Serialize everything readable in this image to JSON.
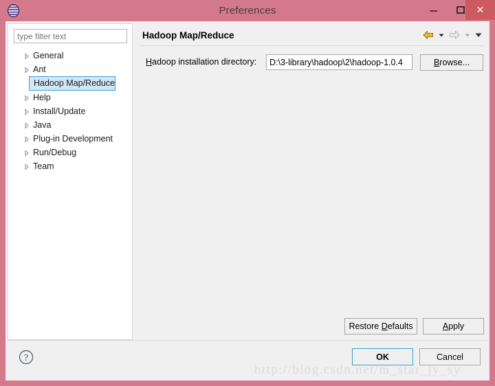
{
  "window": {
    "title": "Preferences",
    "icon": "eclipse-sphere-icon",
    "controls": {
      "minimize": "–",
      "maximize": "□",
      "close": "✕"
    },
    "colors": {
      "titlebar": "#d4798c",
      "close_hover": "#cb5b5f",
      "client": "#f0f0f0",
      "selection": "#cfe8f6",
      "selection_border": "#3c9fce",
      "focus_border": "#3c9fce",
      "back_arrow": "#d9a21c",
      "forward_arrow": "#d6d2c8",
      "caret_dark": "#2b2b2b",
      "caret_purple": "#3b2a6b",
      "watermark": "#e2d8da"
    }
  },
  "sidebar": {
    "filter": {
      "placeholder": "type filter text",
      "value": ""
    },
    "items": [
      {
        "label": "General",
        "expandable": true,
        "selected": false
      },
      {
        "label": "Ant",
        "expandable": true,
        "selected": false
      },
      {
        "label": "Hadoop Map/Reduce",
        "expandable": false,
        "selected": true
      },
      {
        "label": "Help",
        "expandable": true,
        "selected": false
      },
      {
        "label": "Install/Update",
        "expandable": true,
        "selected": false
      },
      {
        "label": "Java",
        "expandable": true,
        "selected": false
      },
      {
        "label": "Plug-in Development",
        "expandable": true,
        "selected": false
      },
      {
        "label": "Run/Debug",
        "expandable": true,
        "selected": false
      },
      {
        "label": "Team",
        "expandable": true,
        "selected": false
      }
    ]
  },
  "content": {
    "title": "Hadoop Map/Reduce",
    "nav": {
      "back_icon": "back-arrow-icon",
      "back_menu_icon": "chevron-down-icon",
      "forward_icon": "forward-arrow-icon",
      "forward_menu_icon": "chevron-down-icon",
      "view_menu_icon": "chevron-down-icon"
    },
    "field": {
      "label": "Hadoop installation directory:",
      "label_prefix": "H",
      "label_rest": "adoop installation directory:",
      "value": "D:\\3-library\\hadoop\\2\\hadoop-1.0.4",
      "placeholder": ""
    },
    "browse_button": {
      "prefix": "B",
      "rest": "rowse..."
    },
    "restore_defaults_button": {
      "pre": "Restore ",
      "prefix": "D",
      "rest": "efaults"
    },
    "apply_button": {
      "prefix": "A",
      "rest": "pply"
    }
  },
  "footer": {
    "help_icon": "help-question-icon",
    "ok_label": "OK",
    "cancel_label": "Cancel"
  },
  "watermark": {
    "text": "http://blog.csdn.net/m_star_jy_sy"
  }
}
